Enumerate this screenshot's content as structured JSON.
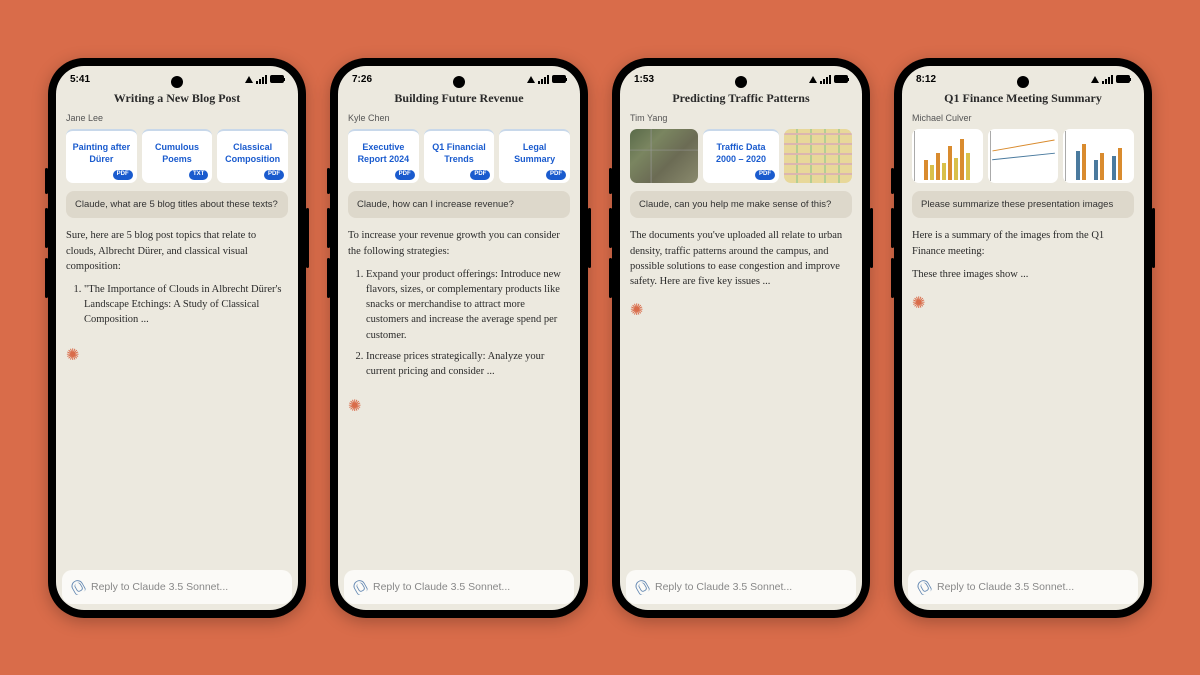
{
  "phones": [
    {
      "time": "5:41",
      "title": "Writing a New Blog Post",
      "user": "Jane Lee",
      "chips": [
        {
          "label": "Painting after Dürer",
          "ext": "PDF"
        },
        {
          "label": "Cumulous Poems",
          "ext": "TXT"
        },
        {
          "label": "Classical Composition",
          "ext": "PDF"
        }
      ],
      "prompt": "Claude, what are 5 blog titles about these texts?",
      "resp_intro": "Sure, here are 5 blog post topics that relate to clouds, Albrecht Dürer, and classical visual composition:",
      "resp_items": [
        "\"The Importance of Clouds in Albrecht Dürer's Landscape Etchings: A Study of Classical Composition ..."
      ],
      "input_placeholder": "Reply to Claude 3.5 Sonnet..."
    },
    {
      "time": "7:26",
      "title": "Building Future Revenue",
      "user": "Kyle Chen",
      "chips": [
        {
          "label": "Executive Report 2024",
          "ext": "PDF"
        },
        {
          "label": "Q1 Financial Trends",
          "ext": "PDF"
        },
        {
          "label": "Legal Summary",
          "ext": "PDF"
        }
      ],
      "prompt": "Claude, how can I increase revenue?",
      "resp_intro": "To increase your revenue growth you can consider the following strategies:",
      "resp_items": [
        "Expand your product offerings: Introduce new flavors, sizes, or complementary products like snacks or merchandise to attract more customers and increase the average spend per customer.",
        "Increase prices strategically: Analyze your current pricing and consider ..."
      ],
      "input_placeholder": "Reply to Claude 3.5 Sonnet..."
    },
    {
      "time": "1:53",
      "title": "Predicting Traffic Patterns",
      "user": "Tim Yang",
      "chip_mixed": {
        "doc": {
          "label": "Traffic Data 2000 – 2020",
          "ext": "PDF"
        }
      },
      "prompt": "Claude, can you help me make sense of this?",
      "resp_intro": "The documents you've uploaded all relate to urban density, traffic patterns around the campus, and possible solutions to ease congestion and improve safety. Here are five key issues ...",
      "resp_items": [],
      "input_placeholder": "Reply to Claude 3.5 Sonnet..."
    },
    {
      "time": "8:12",
      "title": "Q1 Finance Meeting Summary",
      "user": "Michael Culver",
      "charts": true,
      "prompt": "Please summarize these presentation images",
      "resp_intro": "Here is a summary of the images from the Q1 Finance meeting:",
      "resp_extra": "These three images show ...",
      "resp_items": [],
      "input_placeholder": "Reply to Claude 3.5 Sonnet..."
    }
  ]
}
